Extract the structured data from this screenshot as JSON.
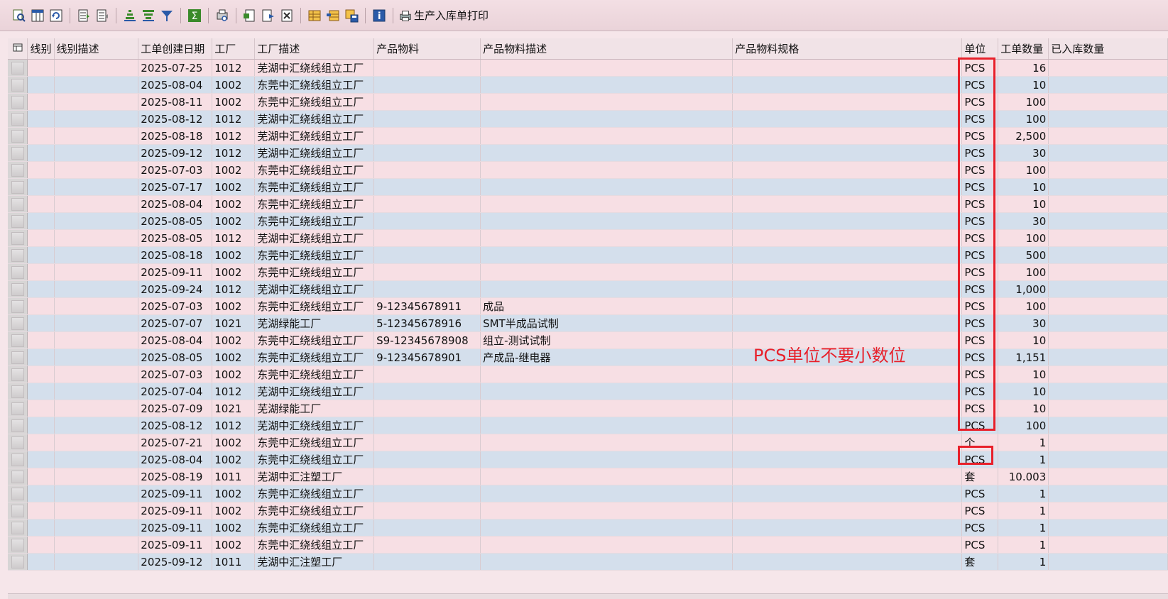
{
  "toolbar": {
    "print_label": "生产入库单打印",
    "icons": [
      "search-icon",
      "columns-icon",
      "refresh-icon",
      "select-all-icon",
      "deselect-icon",
      "sort-asc-icon",
      "sort-desc-icon",
      "filter-icon",
      "sum-icon",
      "print-preview-icon",
      "export-icon",
      "import-icon",
      "delete-layout-icon",
      "layout-icon",
      "change-layout-icon",
      "save-layout-icon",
      "info-icon",
      "printer-icon"
    ]
  },
  "columns": [
    "线别",
    "线别描述",
    "工单创建日期",
    "工厂",
    "工厂描述",
    "产品物料",
    "产品物料描述",
    "产品物料规格",
    "单位",
    "工单数量",
    "已入库数量"
  ],
  "rows": [
    {
      "date": "2025-07-25",
      "plant": "1012",
      "plant_desc": "芜湖中汇绕线组立工厂",
      "mat": "",
      "mat_desc": "",
      "unit": "PCS",
      "qty": "16"
    },
    {
      "date": "2025-08-04",
      "plant": "1002",
      "plant_desc": "东莞中汇绕线组立工厂",
      "mat": "",
      "mat_desc": "",
      "unit": "PCS",
      "qty": "10"
    },
    {
      "date": "2025-08-11",
      "plant": "1002",
      "plant_desc": "东莞中汇绕线组立工厂",
      "mat": "",
      "mat_desc": "",
      "unit": "PCS",
      "qty": "100"
    },
    {
      "date": "2025-08-12",
      "plant": "1012",
      "plant_desc": "芜湖中汇绕线组立工厂",
      "mat": "",
      "mat_desc": "",
      "unit": "PCS",
      "qty": "100"
    },
    {
      "date": "2025-08-18",
      "plant": "1012",
      "plant_desc": "芜湖中汇绕线组立工厂",
      "mat": "",
      "mat_desc": "",
      "unit": "PCS",
      "qty": "2,500"
    },
    {
      "date": "2025-09-12",
      "plant": "1012",
      "plant_desc": "芜湖中汇绕线组立工厂",
      "mat": "",
      "mat_desc": "",
      "unit": "PCS",
      "qty": "30"
    },
    {
      "date": "2025-07-03",
      "plant": "1002",
      "plant_desc": "东莞中汇绕线组立工厂",
      "mat": "",
      "mat_desc": "",
      "unit": "PCS",
      "qty": "100"
    },
    {
      "date": "2025-07-17",
      "plant": "1002",
      "plant_desc": "东莞中汇绕线组立工厂",
      "mat": "",
      "mat_desc": "",
      "unit": "PCS",
      "qty": "10"
    },
    {
      "date": "2025-08-04",
      "plant": "1002",
      "plant_desc": "东莞中汇绕线组立工厂",
      "mat": "",
      "mat_desc": "",
      "unit": "PCS",
      "qty": "10"
    },
    {
      "date": "2025-08-05",
      "plant": "1002",
      "plant_desc": "东莞中汇绕线组立工厂",
      "mat": "",
      "mat_desc": "",
      "unit": "PCS",
      "qty": "30"
    },
    {
      "date": "2025-08-05",
      "plant": "1012",
      "plant_desc": "芜湖中汇绕线组立工厂",
      "mat": "",
      "mat_desc": "",
      "unit": "PCS",
      "qty": "100"
    },
    {
      "date": "2025-08-18",
      "plant": "1002",
      "plant_desc": "东莞中汇绕线组立工厂",
      "mat": "",
      "mat_desc": "",
      "unit": "PCS",
      "qty": "500"
    },
    {
      "date": "2025-09-11",
      "plant": "1002",
      "plant_desc": "东莞中汇绕线组立工厂",
      "mat": "",
      "mat_desc": "",
      "unit": "PCS",
      "qty": "100"
    },
    {
      "date": "2025-09-24",
      "plant": "1012",
      "plant_desc": "芜湖中汇绕线组立工厂",
      "mat": "",
      "mat_desc": "",
      "unit": "PCS",
      "qty": "1,000"
    },
    {
      "date": "2025-07-03",
      "plant": "1002",
      "plant_desc": "东莞中汇绕线组立工厂",
      "mat": "9-12345678911",
      "mat_desc": "成品",
      "unit": "PCS",
      "qty": "100"
    },
    {
      "date": "2025-07-07",
      "plant": "1021",
      "plant_desc": "芜湖绿能工厂",
      "mat": "5-12345678916",
      "mat_desc": "SMT半成品试制",
      "unit": "PCS",
      "qty": "30"
    },
    {
      "date": "2025-08-04",
      "plant": "1002",
      "plant_desc": "东莞中汇绕线组立工厂",
      "mat": "S9-12345678908",
      "mat_desc": "组立-测试试制",
      "unit": "PCS",
      "qty": "10"
    },
    {
      "date": "2025-08-05",
      "plant": "1002",
      "plant_desc": "东莞中汇绕线组立工厂",
      "mat": "9-12345678901",
      "mat_desc": "产成品-继电器",
      "unit": "PCS",
      "qty": "1,151"
    },
    {
      "date": "2025-07-03",
      "plant": "1002",
      "plant_desc": "东莞中汇绕线组立工厂",
      "mat": "",
      "mat_desc": "",
      "unit": "PCS",
      "qty": "10"
    },
    {
      "date": "2025-07-04",
      "plant": "1012",
      "plant_desc": "芜湖中汇绕线组立工厂",
      "mat": "",
      "mat_desc": "",
      "unit": "PCS",
      "qty": "10"
    },
    {
      "date": "2025-07-09",
      "plant": "1021",
      "plant_desc": "芜湖绿能工厂",
      "mat": "",
      "mat_desc": "",
      "unit": "PCS",
      "qty": "10"
    },
    {
      "date": "2025-08-12",
      "plant": "1012",
      "plant_desc": "芜湖中汇绕线组立工厂",
      "mat": "",
      "mat_desc": "",
      "unit": "PCS",
      "qty": "100"
    },
    {
      "date": "2025-07-21",
      "plant": "1002",
      "plant_desc": "东莞中汇绕线组立工厂",
      "mat": "",
      "mat_desc": "",
      "unit": "个",
      "qty": "1"
    },
    {
      "date": "2025-08-04",
      "plant": "1002",
      "plant_desc": "东莞中汇绕线组立工厂",
      "mat": "",
      "mat_desc": "",
      "unit": "PCS",
      "qty": "1"
    },
    {
      "date": "2025-08-19",
      "plant": "1011",
      "plant_desc": "芜湖中汇注塑工厂",
      "mat": "",
      "mat_desc": "",
      "unit": "套",
      "qty": "10.003"
    },
    {
      "date": "2025-09-11",
      "plant": "1002",
      "plant_desc": "东莞中汇绕线组立工厂",
      "mat": "",
      "mat_desc": "",
      "unit": "PCS",
      "qty": "1"
    },
    {
      "date": "2025-09-11",
      "plant": "1002",
      "plant_desc": "东莞中汇绕线组立工厂",
      "mat": "",
      "mat_desc": "",
      "unit": "PCS",
      "qty": "1"
    },
    {
      "date": "2025-09-11",
      "plant": "1002",
      "plant_desc": "东莞中汇绕线组立工厂",
      "mat": "",
      "mat_desc": "",
      "unit": "PCS",
      "qty": "1"
    },
    {
      "date": "2025-09-11",
      "plant": "1002",
      "plant_desc": "东莞中汇绕线组立工厂",
      "mat": "",
      "mat_desc": "",
      "unit": "PCS",
      "qty": "1"
    },
    {
      "date": "2025-09-12",
      "plant": "1011",
      "plant_desc": "芜湖中汇注塑工厂",
      "mat": "",
      "mat_desc": "",
      "unit": "套",
      "qty": "1"
    }
  ],
  "annotation": {
    "text": "PCS单位不要小数位",
    "color": "#e8202a"
  }
}
